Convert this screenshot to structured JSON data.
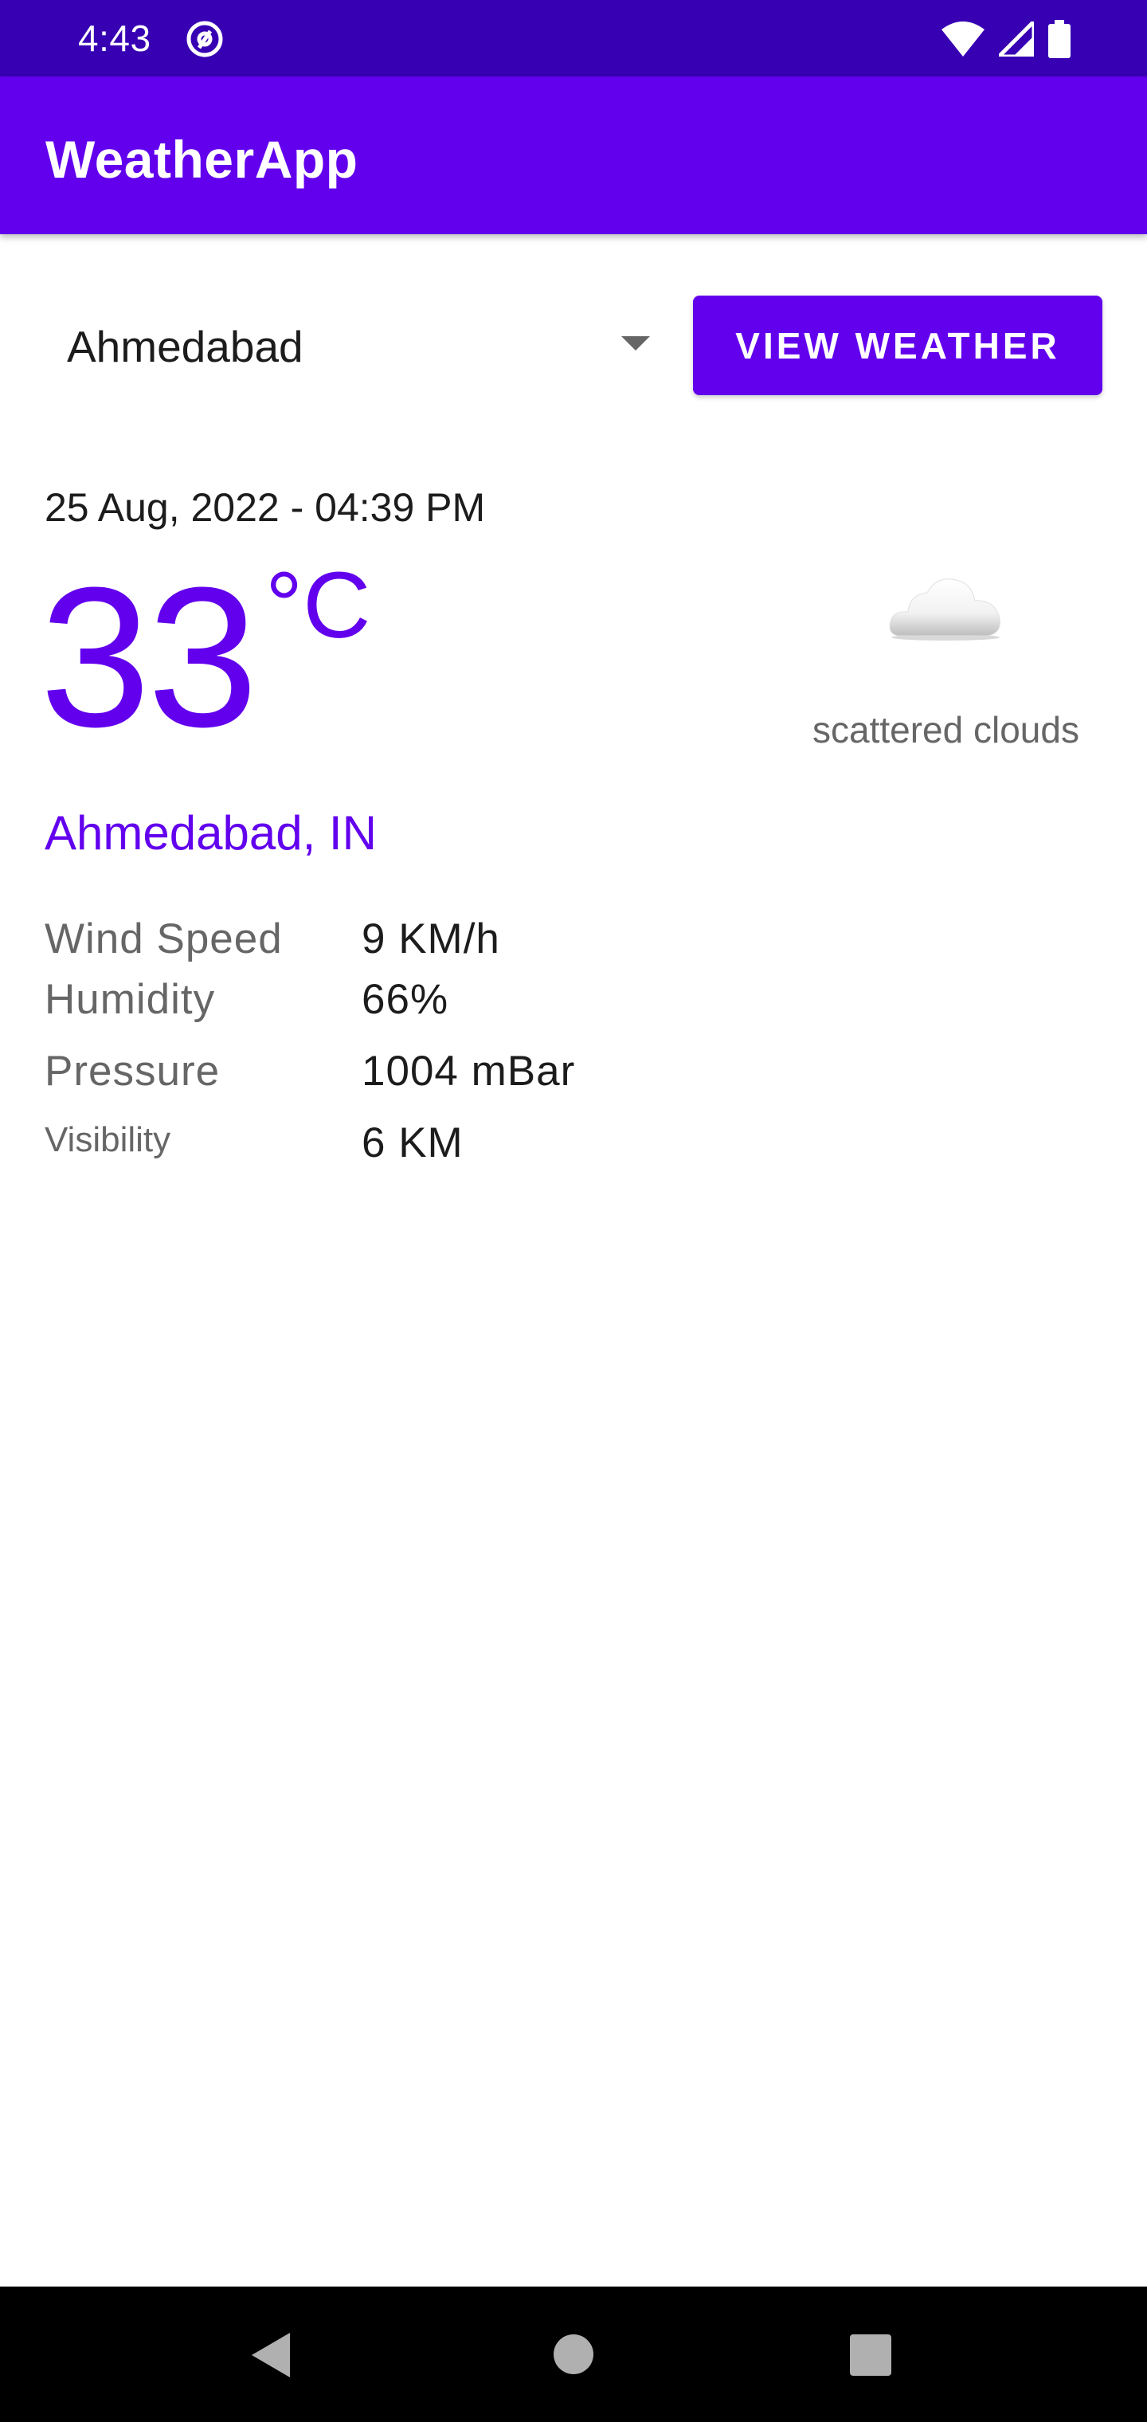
{
  "status_bar": {
    "time": "4:43",
    "icons": [
      "at-sign-icon",
      "wifi-icon",
      "signal-icon",
      "battery-icon"
    ],
    "color": "#3700b3"
  },
  "app_bar": {
    "title": "WeatherApp",
    "color": "#6200ee"
  },
  "city_selector": {
    "selected": "Ahmedabad",
    "icon": "dropdown-arrow-icon"
  },
  "view_button": {
    "label": "VIEW WEATHER"
  },
  "weather": {
    "date_time": "25 Aug, 2022 - 04:39 PM",
    "temperature": "33",
    "unit": "°C",
    "description": "scattered clouds",
    "icon": "cloud-icon",
    "location": "Ahmedabad, IN",
    "accent_color": "#6200ee"
  },
  "details": [
    {
      "label": "Wind Speed",
      "value": "9 KM/h"
    },
    {
      "label": "Humidity",
      "value": "66%"
    },
    {
      "label": "Pressure",
      "value": "1004 mBar"
    },
    {
      "label": "Visibility",
      "value": "6 KM"
    }
  ],
  "nav_bar": {
    "icons": [
      "back-icon",
      "home-icon",
      "recents-icon"
    ]
  }
}
